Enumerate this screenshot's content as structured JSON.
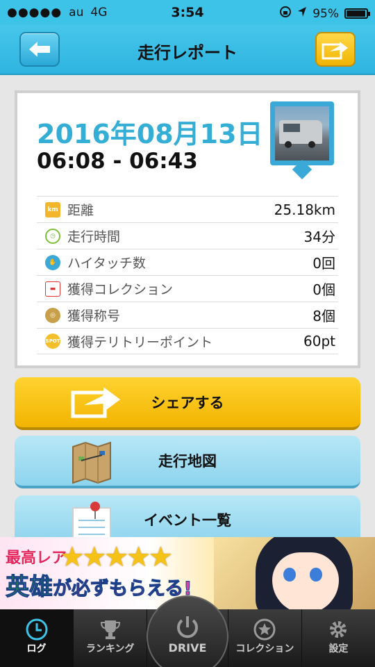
{
  "status_bar": {
    "carrier": "au",
    "network": "4G",
    "time": "3:54",
    "battery": "95%",
    "battery_level": 0.95
  },
  "header": {
    "title": "走行レポート"
  },
  "report": {
    "date": "2016年08月13日",
    "time_range": "06:08 - 06:43",
    "stats": [
      {
        "label": "距離",
        "value": "25.18km",
        "icon": "km-icon"
      },
      {
        "label": "走行時間",
        "value": "34分",
        "icon": "clock-icon"
      },
      {
        "label": "ハイタッチ数",
        "value": "0回",
        "icon": "hand-icon"
      },
      {
        "label": "獲得コレクション",
        "value": "0個",
        "icon": "car-icon"
      },
      {
        "label": "獲得称号",
        "value": "8個",
        "icon": "medal-icon"
      },
      {
        "label": "獲得テリトリーポイント",
        "value": "60pt",
        "icon": "spot-icon"
      }
    ]
  },
  "actions": {
    "share": "シェアする",
    "map": "走行地図",
    "events": "イベント一覧"
  },
  "banner": {
    "line1": "最高レア",
    "line2_a": "英雄",
    "line2_b": "が必ずもらえる!"
  },
  "tabs": [
    {
      "label": "ログ",
      "active": true
    },
    {
      "label": "ランキング",
      "active": false
    },
    {
      "label": "DRIVE",
      "active": false
    },
    {
      "label": "コレクション",
      "active": false
    },
    {
      "label": "設定",
      "active": false
    }
  ],
  "colors": {
    "accent": "#3ec3e8",
    "date": "#35aed6",
    "share": "#f2b400"
  }
}
